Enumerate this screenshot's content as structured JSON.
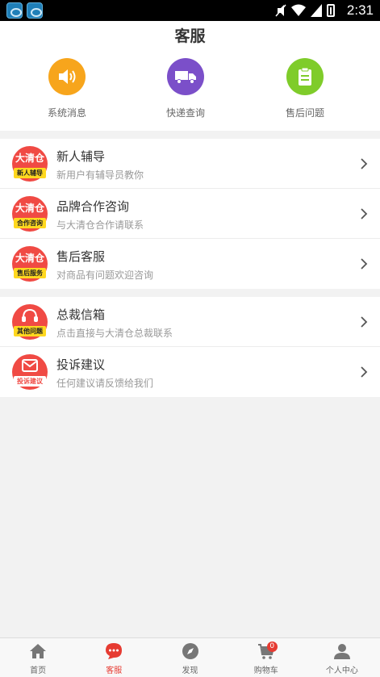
{
  "status_bar": {
    "time": "2:31"
  },
  "header": {
    "title": "客服",
    "quick_actions": [
      {
        "label": "系统消息",
        "icon": "speaker-icon",
        "color": "#f7a51c"
      },
      {
        "label": "快递查询",
        "icon": "truck-icon",
        "color": "#7b4fc9"
      },
      {
        "label": "售后问题",
        "icon": "clipboard-icon",
        "color": "#7fcc2a"
      }
    ]
  },
  "section1": [
    {
      "title": "新人辅导",
      "subtitle": "新用户有辅导员教你",
      "badge_brand": "大清仓",
      "badge_tag": "新人辅导"
    },
    {
      "title": "品牌合作咨询",
      "subtitle": "与大清仓合作请联系",
      "badge_brand": "大清仓",
      "badge_tag": "合作咨询"
    },
    {
      "title": "售后客服",
      "subtitle": "对商品有问题欢迎咨询",
      "badge_brand": "大清仓",
      "badge_tag": "售后服务"
    }
  ],
  "section2": [
    {
      "title": "总裁信箱",
      "subtitle": "点击直接与大清仓总裁联系",
      "badge_tag": "其他问题"
    },
    {
      "title": "投诉建议",
      "subtitle": "任何建议请反馈给我们",
      "badge_tag": "投诉建议"
    }
  ],
  "tabbar": {
    "items": [
      {
        "label": "首页",
        "icon": "home-icon"
      },
      {
        "label": "客服",
        "icon": "chat-icon",
        "active": true
      },
      {
        "label": "发现",
        "icon": "compass-icon"
      },
      {
        "label": "购物车",
        "icon": "cart-icon",
        "badge": "0"
      },
      {
        "label": "个人中心",
        "icon": "person-icon"
      }
    ]
  },
  "colors": {
    "accent": "#e63b32",
    "badge_red": "#f04a44",
    "badge_yellow": "#ffd81f"
  }
}
